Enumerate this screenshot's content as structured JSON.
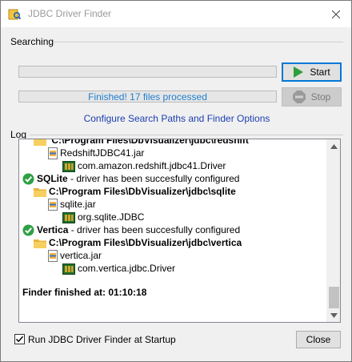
{
  "window": {
    "title": "JDBC Driver Finder"
  },
  "searching": {
    "section_label": "Searching",
    "progress1": {
      "fraction": 0
    },
    "progress2": {
      "text": "Finished! 17 files processed",
      "fraction": 0
    },
    "start_label": "Start",
    "stop_label": "Stop",
    "config_link": "Configure Search Paths and Finder Options"
  },
  "log": {
    "section_label": "Log",
    "partial_top": "C:\\Program Files\\DbVisualizer\\jdbc\\redshift",
    "lines": [
      {
        "kind": "jar",
        "text": "RedshiftJDBC41.jar"
      },
      {
        "kind": "driver",
        "text": "com.amazon.redshift.jdbc41.Driver"
      },
      {
        "kind": "ok",
        "name": "SQLite",
        "suffix": " - driver has been succesfully configured"
      },
      {
        "kind": "folder",
        "text": "C:\\Program Files\\DbVisualizer\\jdbc\\sqlite"
      },
      {
        "kind": "jar",
        "text": "sqlite.jar"
      },
      {
        "kind": "driver",
        "text": "org.sqlite.JDBC"
      },
      {
        "kind": "ok",
        "name": "Vertica",
        "suffix": " - driver has been succesfully configured"
      },
      {
        "kind": "folder",
        "text": "C:\\Program Files\\DbVisualizer\\jdbc\\vertica"
      },
      {
        "kind": "jar",
        "text": "vertica.jar"
      },
      {
        "kind": "driver",
        "text": "com.vertica.jdbc.Driver"
      }
    ],
    "finished": "Finder finished at: 01:10:18"
  },
  "footer": {
    "checkbox_label": "Run JDBC Driver Finder at Startup",
    "checkbox_checked": true,
    "close_label": "Close"
  },
  "colors": {
    "accent": "#0078d7",
    "link": "#1c3fb0",
    "ok_green": "#2ea043",
    "progress_text": "#1f7ed0"
  }
}
